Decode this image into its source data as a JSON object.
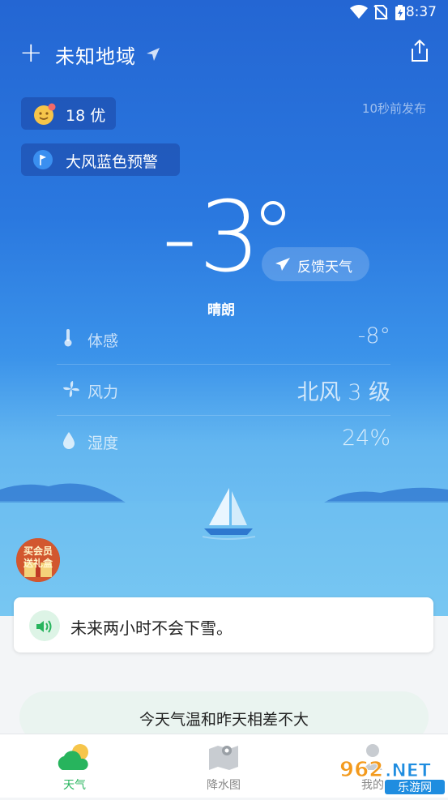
{
  "status_bar": {
    "time": "8:37"
  },
  "header": {
    "location": "未知地域"
  },
  "aqi": {
    "value": "18 优"
  },
  "alert": {
    "label": "大风蓝色预警"
  },
  "publish_time": "10秒前发布",
  "current": {
    "temperature": "-3",
    "condition": "晴朗",
    "feedback_label": "反馈天气"
  },
  "details": [
    {
      "label": "体感",
      "value": "-8°",
      "icon": "thermometer-icon"
    },
    {
      "label": "风力",
      "value": "北风 3 级",
      "icon": "wind-fan-icon"
    },
    {
      "label": "湿度",
      "value": "24%",
      "icon": "water-drop-icon"
    }
  ],
  "promo": {
    "text": "买会员送礼盒"
  },
  "nowcast": {
    "text": "未来两小时不会下雪。"
  },
  "compare": {
    "text": "今天气温和昨天相差不大"
  },
  "nav": [
    {
      "label": "天气",
      "active": true
    },
    {
      "label": "降水图",
      "active": false
    },
    {
      "label": "我的",
      "active": false
    }
  ],
  "watermark": {
    "text": "962.NET",
    "sub": "乐游网"
  },
  "colors": {
    "accent_green": "#27b45d",
    "hero_top": "#2466d3",
    "hero_bottom": "#7cc9f3"
  }
}
